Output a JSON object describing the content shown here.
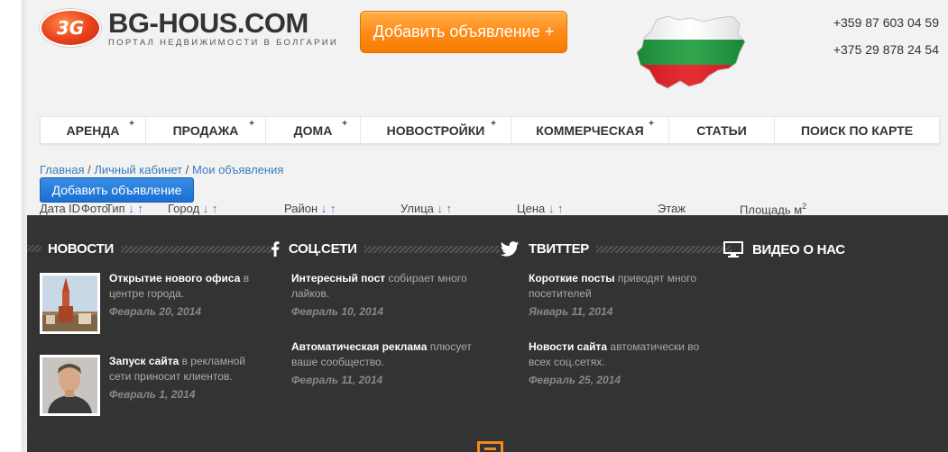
{
  "header": {
    "logo_badge": "3G",
    "logo_name": "BG-HOUS.COM",
    "logo_sub": "ПОРТАЛ НЕДВИЖИМОСТИ В БОЛГАРИИ",
    "add_ad_label": "Добавить объявление +",
    "phones": [
      "+359 87 603 04 59",
      "+375 29 878 24 54"
    ]
  },
  "nav": {
    "items": [
      {
        "label": "АРЕНДА",
        "plus": "+"
      },
      {
        "label": "ПРОДАЖА",
        "plus": "+"
      },
      {
        "label": "ДОМА",
        "plus": "+"
      },
      {
        "label": "НОВОСТРОЙКИ",
        "plus": "+"
      },
      {
        "label": "КОММЕРЧЕСКАЯ",
        "plus": "+"
      },
      {
        "label": "СТАТЬИ",
        "plus": ""
      },
      {
        "label": "ПОИСК ПО КАРТЕ",
        "plus": ""
      }
    ]
  },
  "breadcrumb": {
    "home": "Главная",
    "sep": " / ",
    "cabinet": "Личный кабинет",
    "current": "Мои объявления"
  },
  "add_ad_button": "Добавить объявление",
  "table": {
    "columns": [
      "Дата",
      "ID",
      "Фото",
      "Тип",
      "Город",
      "Район",
      "Улица",
      "Цена",
      "Этаж",
      "Площадь м"
    ],
    "sort_arrows": "↓ ↑",
    "area_sup": "2"
  },
  "footer": {
    "news": {
      "title": "НОВОСТИ",
      "posts": [
        {
          "title": "Открытие нового офиса",
          "text": " в центре города.",
          "date": "Февраль 20, 2014"
        },
        {
          "title": "Запуск сайта",
          "text": " в рекламной сети приносит клиентов.",
          "date": "Февраль 1, 2014"
        }
      ]
    },
    "social": {
      "title": "СОЦ.СЕТИ",
      "icon": "facebook-icon",
      "posts": [
        {
          "title": "Интересный пост",
          "text": " собирает много лайков.",
          "date": "Февраль 10, 2014"
        },
        {
          "title": "Автоматическая реклама",
          "text": " плюсует ваше сообщество.",
          "date": "Февраль 11, 2014"
        }
      ]
    },
    "twitter": {
      "title": "ТВИТТЕР",
      "icon": "twitter-icon",
      "posts": [
        {
          "title": "Короткие посты",
          "text": " приводят много посетителей",
          "date": "Январь 11, 2014"
        },
        {
          "title": "Новости сайта",
          "text": " автоматически во всех соц.сетях.",
          "date": "Февраль 25, 2014"
        }
      ]
    },
    "video": {
      "title": "ВИДЕО О НАС",
      "icon": "monitor-icon"
    }
  },
  "colors": {
    "accent_orange": "#ff8c1a",
    "link_blue": "#3a7cc0",
    "footer_bg": "#333333"
  }
}
